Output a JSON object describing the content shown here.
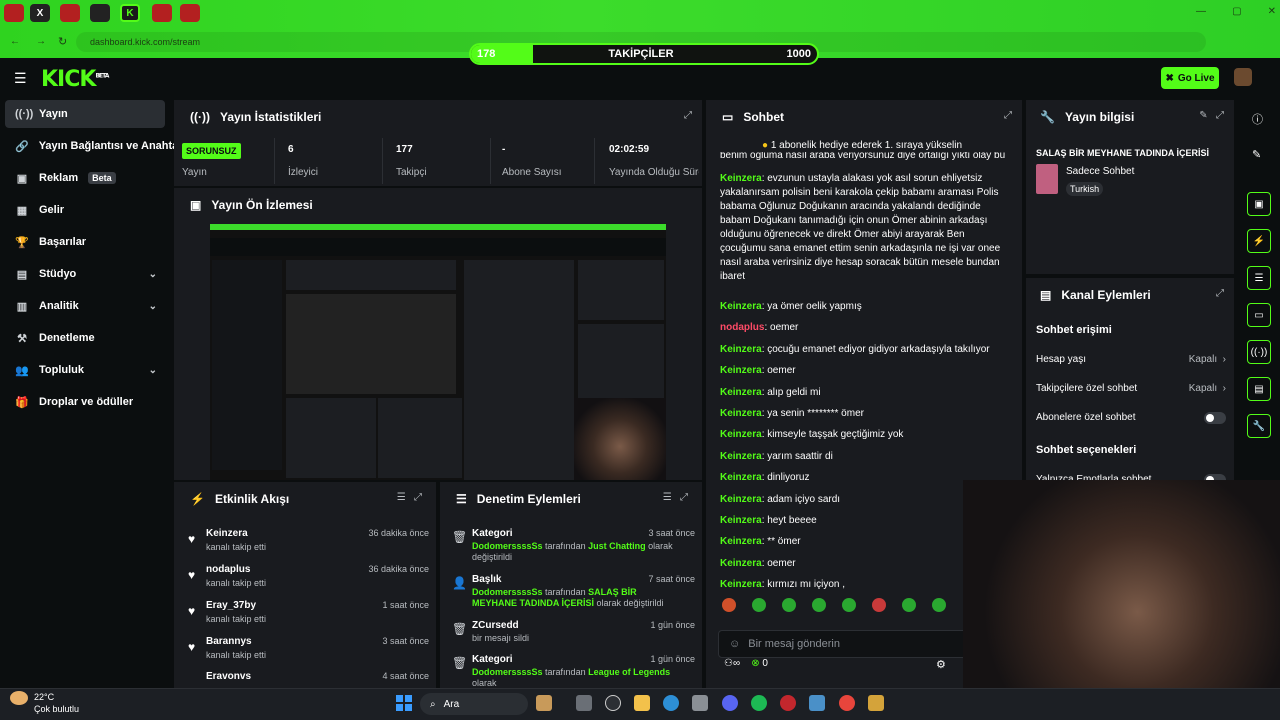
{
  "browser": {
    "url": "dashboard.kick.com/stream",
    "tabs": [
      "",
      "X",
      "",
      "",
      "K",
      ""
    ]
  },
  "follower_goal": {
    "current": "178",
    "label": "TAKİPÇİLER",
    "target": "1000",
    "progress": 0.178
  },
  "header": {
    "logo": "KICK",
    "beta_badge": "BETA",
    "go_live": "Go Live"
  },
  "sidebar": {
    "items": [
      {
        "label": "Yayın",
        "icon": "broadcast-icon"
      },
      {
        "label": "Yayın Bağlantısı ve Anahtarı",
        "icon": "link-icon"
      },
      {
        "label": "Reklam",
        "badge": "Beta",
        "icon": "ad-icon"
      },
      {
        "label": "Gelir",
        "icon": "revenue-icon"
      },
      {
        "label": "Başarılar",
        "icon": "trophy-icon"
      },
      {
        "label": "Stüdyo",
        "icon": "studio-icon"
      },
      {
        "label": "Analitik",
        "icon": "analytics-icon"
      },
      {
        "label": "Denetleme",
        "icon": "gavel-icon"
      },
      {
        "label": "Topluluk",
        "icon": "community-icon"
      },
      {
        "label": "Droplar ve ödüller",
        "icon": "gift-icon"
      }
    ]
  },
  "stats": {
    "title": "Yayın İstatistikleri",
    "status": "SORUNSUZ",
    "status_label": "Yayın",
    "viewers": "6",
    "viewers_label": "İzleyici",
    "followers": "177",
    "followers_label": "Takipçi",
    "subs": "-",
    "subs_label": "Abone Sayısı",
    "uptime": "02:02:59",
    "uptime_label": "Yayında Olduğu Süre"
  },
  "preview": {
    "title": "Yayın Ön İzlemesi"
  },
  "activity": {
    "title": "Etkinlik Akışı",
    "items": [
      {
        "name": "Keinzera",
        "desc": "kanalı takip etti",
        "time": "36 dakika önce"
      },
      {
        "name": "nodaplus",
        "desc": "kanalı takip etti",
        "time": "36 dakika önce"
      },
      {
        "name": "Eray_37by",
        "desc": "kanalı takip etti",
        "time": "1 saat önce"
      },
      {
        "name": "Barannys",
        "desc": "kanalı takip etti",
        "time": "3 saat önce"
      },
      {
        "name": "Eravonvs",
        "desc": "",
        "time": "4 saat önce"
      }
    ]
  },
  "moderation": {
    "title": "Denetim Eylemleri",
    "items": [
      {
        "type": "Kategori",
        "user": "DodomerssssSs",
        "mid": " tarafından ",
        "value": "Just Chatting",
        "tail": " olarak değiştirildi",
        "time": "3 saat önce"
      },
      {
        "type": "Başlık",
        "user": "DodomerssssSs",
        "mid": " tarafından ",
        "value": "SALAŞ BİR MEYHANE TADINDA İÇERİSİ",
        "tail": " olarak değiştirildi",
        "time": "7 saat önce"
      },
      {
        "type": "ZCursedd",
        "user": "",
        "mid": "bir mesajı sildi",
        "value": "",
        "tail": "",
        "time": "1 gün önce"
      },
      {
        "type": "Kategori",
        "user": "DodomerssssSs",
        "mid": " tarafından ",
        "value": "League of Legends",
        "tail": " olarak",
        "time": "1 gün önce"
      }
    ]
  },
  "chat": {
    "title": "Sohbet",
    "pinned": "1 abonelik hediye ederek 1. sıraya yükselin",
    "top_cut": "benim oğluma nasıl araba veriyorsunuz diye ortalığı yıktı olay bu",
    "messages": [
      {
        "user": "Keinzera",
        "text": "evzunun ustayla alakası yok asıl sorun ehliyetsiz yakalanırsam polisin beni karakola çekip babamı araması Polis babama Oğlunuz Doğukanın aracında yakalandı dediğinde babam Doğukanı tanımadığı için onun Ömer abinin arkadaşı olduğunu öğrenecek ve direkt Ömer abiyi arayarak Ben çocuğumu sana emanet ettim senin arkadaşınla ne işi var onee nasıl araba verirsiniz diye hesap soracak bütün mesele bundan ibaret",
        "red": false
      },
      {
        "user": "Keinzera",
        "text": "ya ömer oelik yapmış",
        "red": false
      },
      {
        "user": "nodaplus",
        "text": "oemer",
        "red": true
      },
      {
        "user": "Keinzera",
        "text": "çocuğu emanet ediyor gidiyor arkadaşıyla takılıyor",
        "red": false
      },
      {
        "user": "Keinzera",
        "text": "oemer",
        "red": false
      },
      {
        "user": "Keinzera",
        "text": "alıp geldi mi",
        "red": false
      },
      {
        "user": "Keinzera",
        "text": "ya senin ******** ömer",
        "red": false
      },
      {
        "user": "Keinzera",
        "text": "kimseyle taşşak geçtiğimiz yok",
        "red": false
      },
      {
        "user": "Keinzera",
        "text": "yarım saattir di",
        "red": false
      },
      {
        "user": "Keinzera",
        "text": "dinliyoruz",
        "red": false
      },
      {
        "user": "Keinzera",
        "text": "adam içiyo sardı",
        "red": false
      },
      {
        "user": "Keinzera",
        "text": "heyt beeee",
        "red": false
      },
      {
        "user": "Keinzera",
        "text": "** ömer",
        "red": false
      },
      {
        "user": "Keinzera",
        "text": "oemer",
        "red": false
      },
      {
        "user": "Keinzera",
        "text": "kırmızı mı içiyon ,",
        "red": false
      }
    ],
    "input_placeholder": "Bir mesaj gönderin",
    "points": "0"
  },
  "stream_info": {
    "title": "Yayın bilgisi",
    "stream_title": "SALAŞ BİR MEYHANE TADINDA İÇERİSİ",
    "category": "Sadece Sohbet",
    "tag": "Turkish"
  },
  "channel_actions": {
    "title": "Kanal Eylemleri",
    "chat_access": "Sohbet erişimi",
    "rows": [
      {
        "label": "Hesap yaşı",
        "value": "Kapalı"
      },
      {
        "label": "Takipçilere özel sohbet",
        "value": "Kapalı"
      },
      {
        "label": "Abonelere özel sohbet",
        "value": ""
      }
    ],
    "chat_options": "Sohbet seçenekleri",
    "emote_only": "Yalnızca Emotlarla sohbet"
  },
  "taskbar": {
    "temp": "22°C",
    "weather": "Çok bulutlu",
    "search": "Ara"
  },
  "colors": {
    "accent": "#53fc18",
    "panel": "#191b1f",
    "bg": "#0b0e0f",
    "red_user": "#ff4b67"
  }
}
